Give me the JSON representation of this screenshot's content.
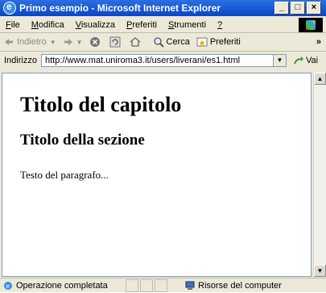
{
  "window": {
    "title": "Primo esempio - Microsoft Internet Explorer"
  },
  "menu": [
    {
      "label": "File",
      "u": "F",
      "rest": "ile"
    },
    {
      "label": "Modifica",
      "u": "M",
      "rest": "odifica"
    },
    {
      "label": "Visualizza",
      "u": "V",
      "rest": "isualizza"
    },
    {
      "label": "Preferiti",
      "u": "P",
      "rest": "referiti"
    },
    {
      "label": "Strumenti",
      "u": "S",
      "rest": "trumenti"
    },
    {
      "label": "?",
      "u": "?",
      "rest": ""
    }
  ],
  "toolbar": {
    "back_label": "Indietro",
    "search_label": "Cerca",
    "favorites_label": "Preferiti",
    "more": "»"
  },
  "address": {
    "label": "Indirizzo",
    "url": "http://www.mat.uniroma3.it/users/liverani/es1.html",
    "go_label": "Vai"
  },
  "page": {
    "h1": "Titolo del capitolo",
    "h2": "Titolo della sezione",
    "p": "Testo del paragrafo..."
  },
  "status": {
    "left": "Operazione completata",
    "right": "Risorse del computer"
  }
}
